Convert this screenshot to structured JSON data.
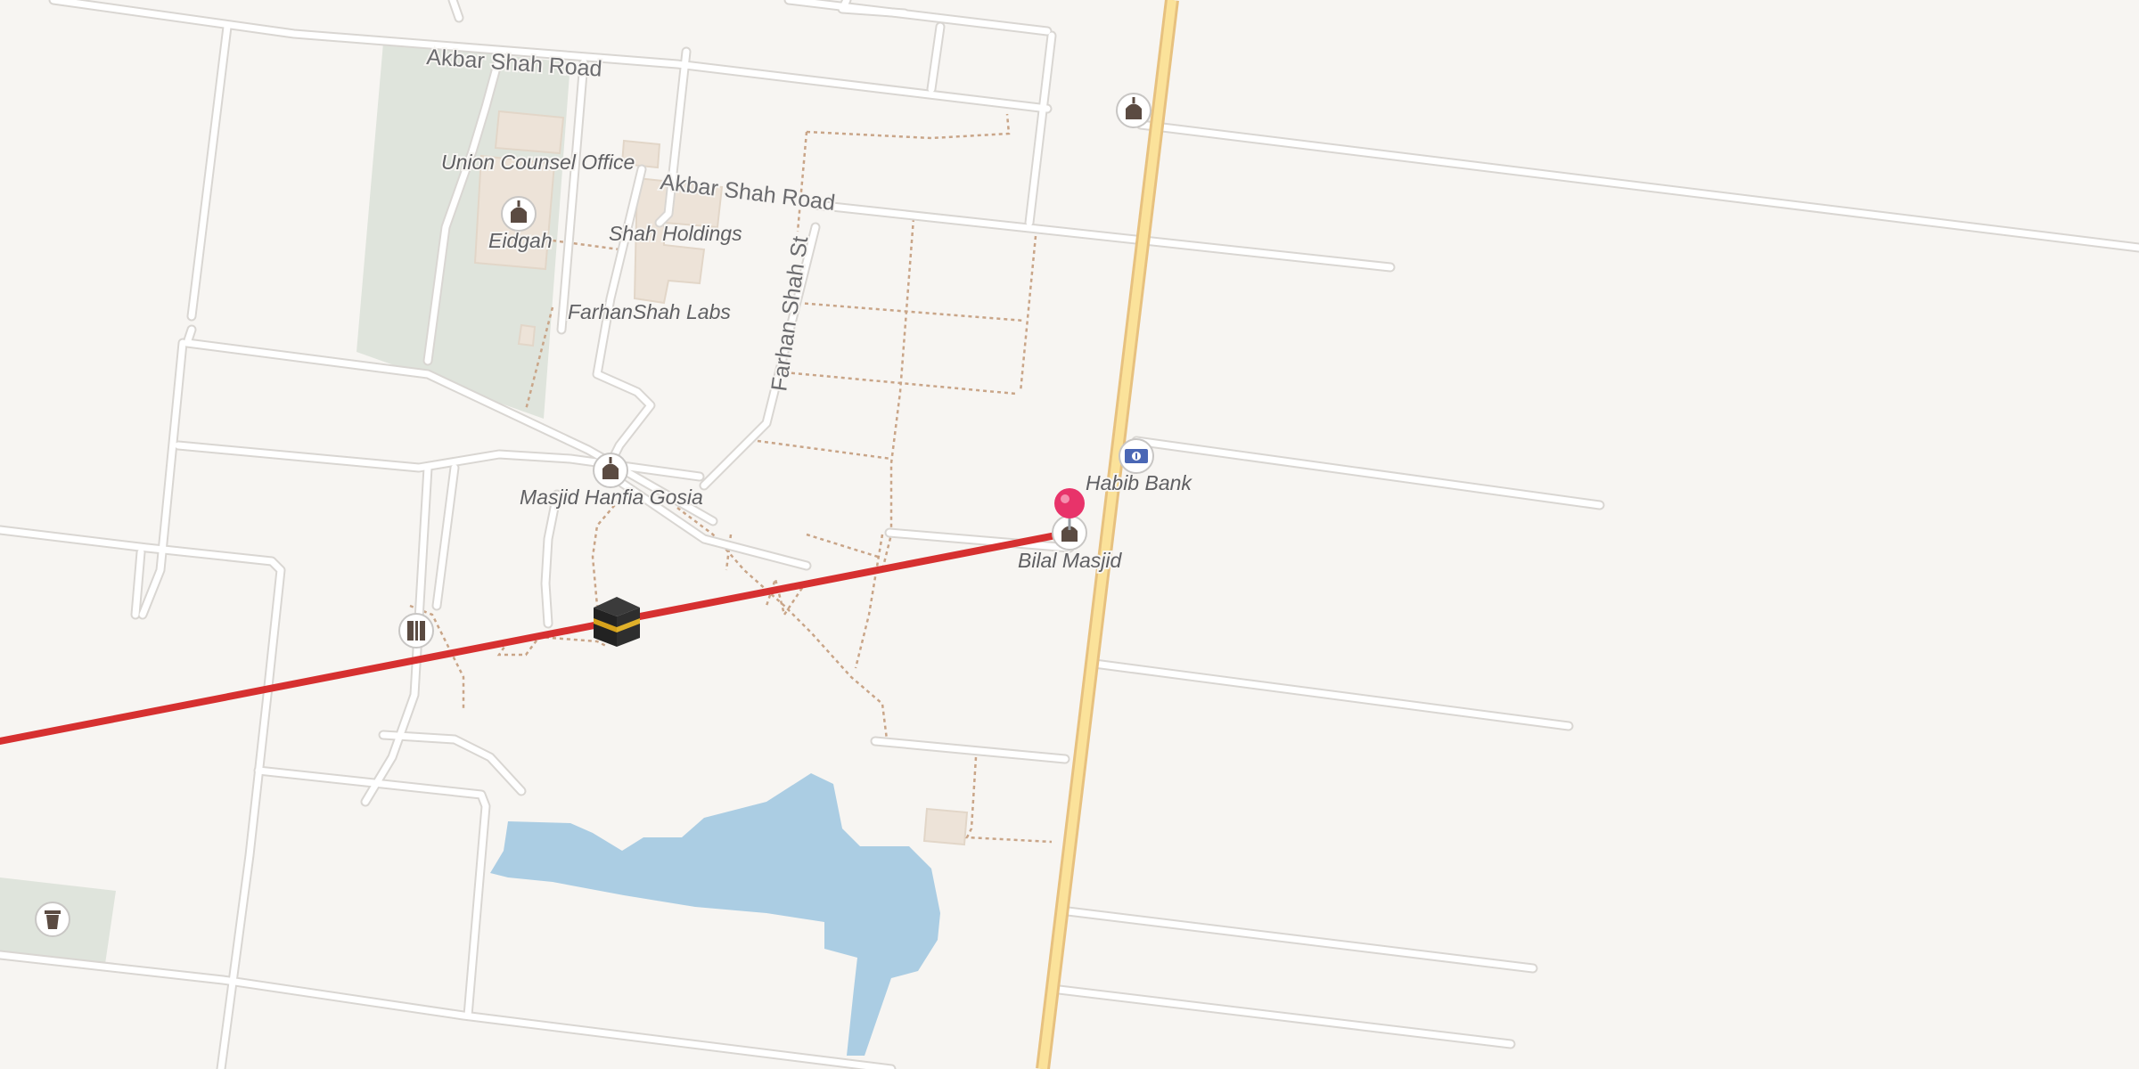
{
  "map": {
    "type": "street-map",
    "colors": {
      "background": "#f7f5f2",
      "park": "#dfe4dc",
      "water": "#abcde3",
      "building": "#ede3d8",
      "highway": "#f5c672",
      "route": "#d63030",
      "marker": "#e8336a"
    },
    "road_labels": {
      "akbar_shah_road_1": "Akbar Shah Road",
      "akbar_shah_road_2": "Akbar Shah Road",
      "farhan_shah_st": "Farhan Shah St"
    },
    "poi_labels": {
      "union_counsel_office": "Union Counsel Office",
      "eidgah": "Eidgah",
      "shah_holdings": "Shah Holdings",
      "farhanshah_labs": "FarhanShah Labs",
      "masjid_hanfia_gosia": "Masjid Hanfia Gosia",
      "habib_bank": "Habib Bank",
      "bilal_masjid": "Bilal Masjid"
    },
    "icons": {
      "mosque": "mosque-icon",
      "bank": "bank-icon",
      "kaaba": "kaaba-icon",
      "library": "library-icon",
      "waste": "waste-basket-icon",
      "pin": "location-pin-icon"
    }
  }
}
